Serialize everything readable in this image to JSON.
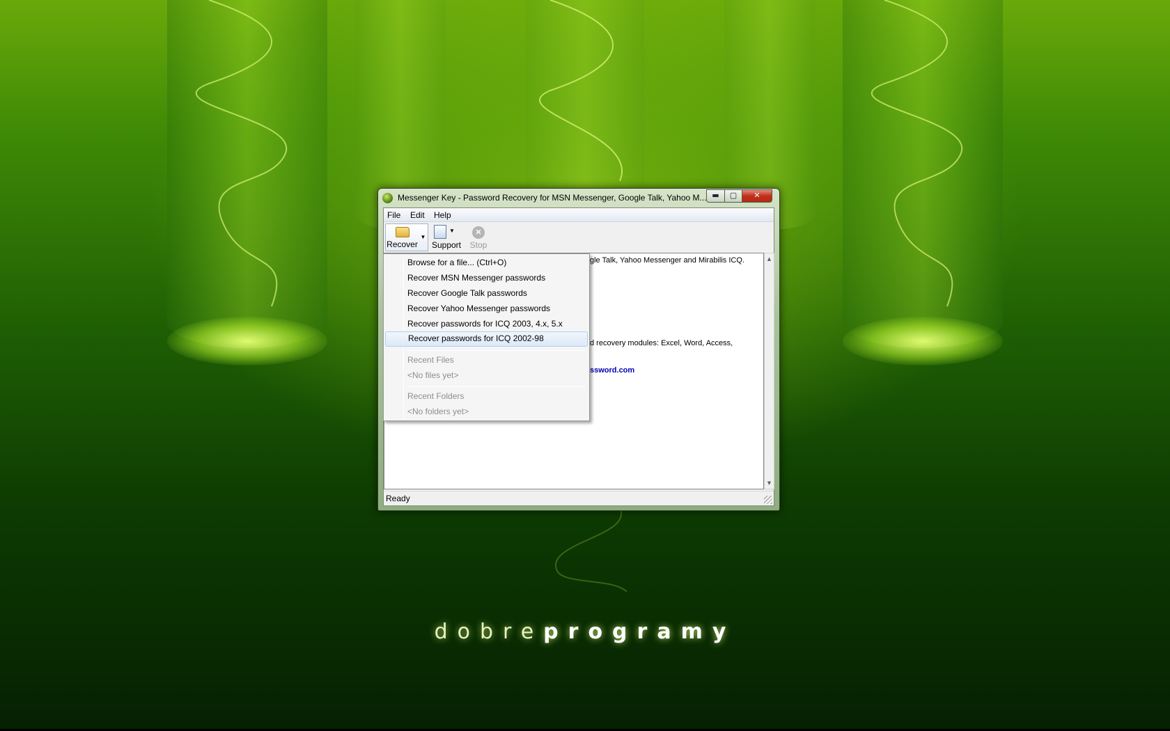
{
  "window": {
    "title": "Messenger Key - Password Recovery for MSN Messenger, Google Talk, Yahoo M...",
    "close_glyph": "✕",
    "minimize_glyph": "▬",
    "maximize_glyph": "▢"
  },
  "menubar": {
    "file": "File",
    "edit": "Edit",
    "help": "Help"
  },
  "toolbar": {
    "recover": "Recover",
    "support": "Support",
    "stop": "Stop",
    "dropdown_glyph": "▼",
    "stop_glyph": "✕"
  },
  "content": {
    "line1": "gle Talk, Yahoo Messenger and Mirabilis ICQ.",
    "line2": "d recovery modules: Excel, Word, Access,",
    "link": "ssword.com"
  },
  "dropdown": {
    "browse": "Browse for a file... (Ctrl+O)",
    "msn": "Recover MSN Messenger passwords",
    "gtalk": "Recover Google Talk passwords",
    "yahoo": "Recover Yahoo Messenger passwords",
    "icq_new": "Recover passwords for ICQ 2003, 4.x, 5.x",
    "icq_old": "Recover passwords for ICQ 2002-98",
    "recent_files_header": "Recent Files",
    "no_files": "<No files yet>",
    "recent_folders_header": "Recent Folders",
    "no_folders": "<No folders yet>"
  },
  "status": {
    "text": "Ready"
  },
  "wallpaper": {
    "brand_light": "dobre",
    "brand_bold": "programy"
  },
  "colors": {
    "wallpaper_green": "#3f8a06",
    "link_blue": "#0000b0",
    "close_red": "#c0301a"
  }
}
